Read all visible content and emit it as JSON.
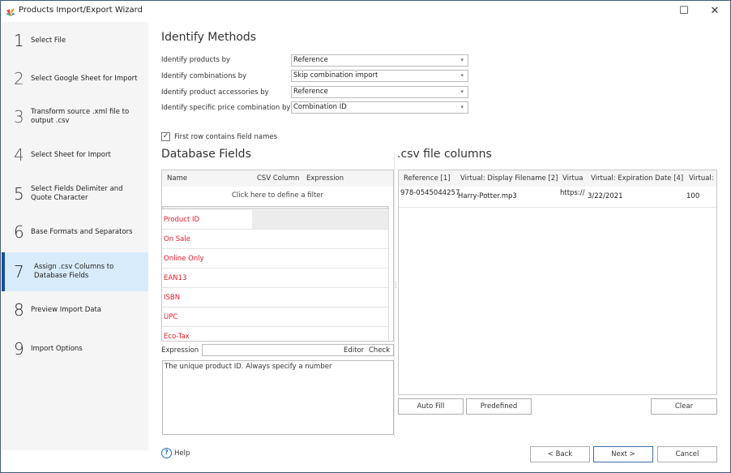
{
  "window": {
    "title": "Products Import/Export Wizard",
    "app_icon": "app-logo-icon",
    "maximize_glyph": "☐",
    "close_glyph": "✕"
  },
  "sidebar": {
    "active_index": 6,
    "steps": [
      {
        "num": "1",
        "label": "Select File"
      },
      {
        "num": "2",
        "label": "Select Google Sheet for Import"
      },
      {
        "num": "3",
        "label": "Transform source .xml file to output .csv"
      },
      {
        "num": "4",
        "label": "Select Sheet for Import"
      },
      {
        "num": "5",
        "label": "Select Fields Delimiter and Quote Character"
      },
      {
        "num": "6",
        "label": "Base Formats and Separators"
      },
      {
        "num": "7",
        "label": "Assign .csv Columns to Database Fields"
      },
      {
        "num": "8",
        "label": "Preview Import Data"
      },
      {
        "num": "9",
        "label": "Import Options"
      }
    ]
  },
  "identify": {
    "title": "Identify Methods",
    "rows": [
      {
        "label": "Identify products by",
        "value": "Reference"
      },
      {
        "label": "Identify combinations by",
        "value": "Skip combination import"
      },
      {
        "label": "Identify product accessories by",
        "value": "Reference"
      },
      {
        "label": "Identify specific price combination by",
        "value": "Combination ID"
      }
    ],
    "dropdown_glyph": "▾"
  },
  "first_row_checkbox": {
    "label": "First row contains field names",
    "checked": true,
    "glyph": "✓"
  },
  "database_fields": {
    "title": "Database Fields",
    "columns": [
      "Name",
      "CSV Column",
      "Expression"
    ],
    "filter_text": "Click here to define a filter",
    "rows": [
      {
        "name": "Product ID"
      },
      {
        "name": "On Sale"
      },
      {
        "name": "Online Only"
      },
      {
        "name": "EAN13"
      },
      {
        "name": "ISBN"
      },
      {
        "name": "UPC"
      },
      {
        "name": "Eco-Tax"
      }
    ],
    "field_color": "#e8182a"
  },
  "expression": {
    "label": "Expression",
    "value": "",
    "editor_label": "Editor",
    "check_label": "Check",
    "description": "The unique product ID. Always specify a number"
  },
  "csv_columns": {
    "title": ".csv file columns",
    "columns": [
      "Reference [1]",
      "Virtual: Display Filename [2]",
      "Virtua",
      "Virtual: Expiration Date [4]",
      "Virtual: I"
    ],
    "rows": [
      [
        "978-0545044257",
        "Harry-Potter.mp3",
        "https://",
        "3/22/2021",
        "100"
      ]
    ]
  },
  "csv_buttons": {
    "auto_fill": "Auto Fill",
    "predefined": "Predefined",
    "clear": "Clear"
  },
  "footer": {
    "help_label": "Help",
    "help_glyph": "?",
    "back_label": "< Back",
    "next_label": "Next >",
    "cancel_label": "Cancel"
  },
  "colors": {
    "accent": "#1a4f94",
    "active_step_bg": "#d8ebfa",
    "required_field": "#e8182a"
  }
}
